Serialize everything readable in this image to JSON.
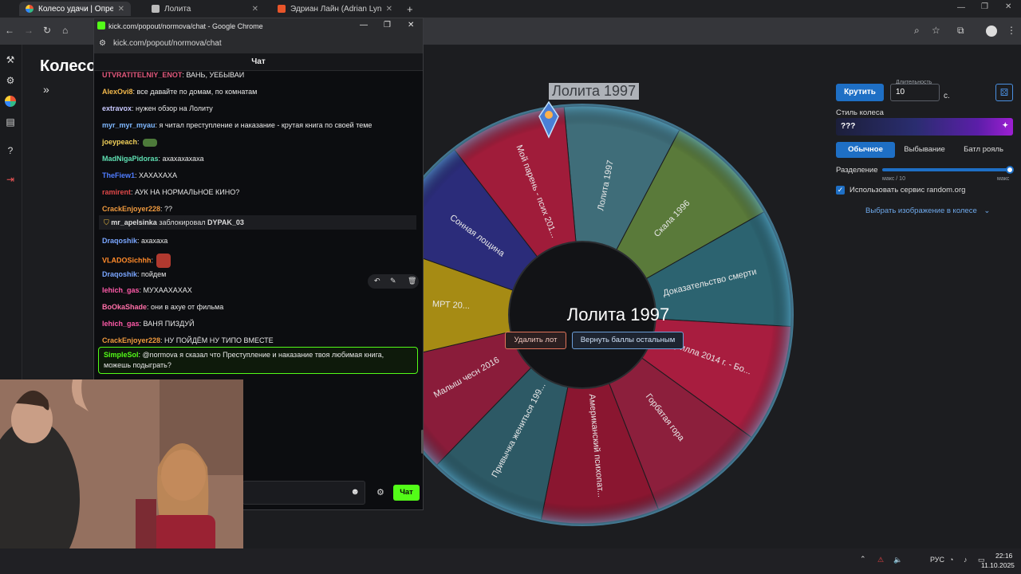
{
  "browser": {
    "tabs": [
      {
        "title": "Колесо удачи | Определите п",
        "active": true
      },
      {
        "title": "Лолита",
        "active": false
      },
      {
        "title": "Эдриан Лайн (Adrian Lyne): ф",
        "active": false
      }
    ],
    "new_tab": "+"
  },
  "app": {
    "heading": "Колесо",
    "collapse_icon": "»"
  },
  "wheel": {
    "top_label": "Лолита 1997",
    "center_title": "Лолита 1997",
    "delete_btn": "Удалить лот",
    "return_btn": "Вернуть баллы остальным",
    "segments": [
      {
        "label": "Лолита 1997",
        "color": "#3f6d79"
      },
      {
        "label": "Скала 1996",
        "color": "#5a7a3a"
      },
      {
        "label": "Доказательство смерти",
        "color": "#2c6370"
      },
      {
        "label": "Годзилла 2014 г. - Бо...",
        "color": "#a81d3f"
      },
      {
        "label": "Горбатая гора",
        "color": "#8c1f3c"
      },
      {
        "label": "Американский психопат...",
        "color": "#8a1630"
      },
      {
        "label": "Привычка жениться 199...",
        "color": "#2d5965"
      },
      {
        "label": "Малыш чесн 2016",
        "color": "#8a1c3a"
      },
      {
        "label": "МРТ 20...",
        "color": "#a68b14"
      },
      {
        "label": "Сонная лощина",
        "color": "#2b2c7a"
      },
      {
        "label": "Мой парень - псих 201...",
        "color": "#a01c3a"
      }
    ]
  },
  "controls": {
    "spin": "Крутить",
    "duration_label": "Длительность",
    "duration_value": "10",
    "duration_unit": "с.",
    "style_label": "Стиль колеса",
    "style_value": "???",
    "style_tabs": [
      "Обычное",
      "Выбывание",
      "Батл рояль"
    ],
    "split_label": "Разделение",
    "split_min": "макс / 10",
    "split_max": "макс",
    "split_fraction": 1.0,
    "randomorg_label": "Использовать сервис random.org",
    "choose_image": "Выбрать изображение в колесе"
  },
  "chat": {
    "window_title": "kick.com/popout/normova/chat - Google Chrome",
    "url": "kick.com/popout/normova/chat",
    "header": "Чат",
    "messages": [
      {
        "user": "UTVRATITELNIY_ENOT",
        "text": ": ВАНЬ, УЕБЫВАИ",
        "color": "#e0577a"
      },
      {
        "user": "AlexOvi8",
        "text": ": все давайте по домам, по комнатам",
        "color": "#f2b84b"
      },
      {
        "user": "extravox",
        "text": ": нужен обзор на Лолиту",
        "color": "#c9c9ff"
      },
      {
        "user": "myr_myr_myau",
        "text": ": я читал преступление и наказание - крутая книга по своей теме",
        "color": "#7fb8ff"
      },
      {
        "user": "joeypeach",
        "text": ":",
        "color": "#f2d15a"
      },
      {
        "user": "MadNigaPidoras",
        "text": ": ахахахахаха",
        "color": "#5fe0b3"
      },
      {
        "user": "TheFiew1",
        "text": ": ХАХАХАХА",
        "color": "#4f7cff"
      },
      {
        "user": "ramirent",
        "text": ": АУК НА НОРМАЛЬНОЕ КИНО?",
        "color": "#e04848"
      },
      {
        "user": "CrackEnjoyer228",
        "text": ": ??",
        "color": "#f09a3e"
      },
      {
        "user": "Draqoshik",
        "text": ": ахахаха",
        "color": "#7aa6ff"
      },
      {
        "user": "VLADOSichhh",
        "text": ":",
        "color": "#ff8a2a"
      },
      {
        "user": "Draqoshik",
        "text": ": пойдем",
        "color": "#7aa6ff"
      },
      {
        "user": "lehich_gas",
        "text": ": МУХААХАХАХ",
        "color": "#ff5aa8"
      },
      {
        "user": "BoOkaShade",
        "text": ": они в ахуе от фильма",
        "color": "#ff6fa8"
      },
      {
        "user": "lehich_gas",
        "text": ": ВАНЯ ПИЗДУЙ",
        "color": "#ff5aa8"
      },
      {
        "user": "CrackEnjoyer228",
        "text": ": НУ ПОЙДЁМ НУ ТИПО ВМЕСТЕ",
        "color": "#f09a3e"
      }
    ],
    "system": {
      "moderator": "mr_apelsinka",
      "action": "заблокировал",
      "target": "DYPAK_03"
    },
    "highlight": {
      "user": "SimpleSol",
      "line1": ": @normova я сказал что Преступление и наказание твоя любимая книга,",
      "line2": "можешь подыграть?"
    },
    "send": "Чат"
  },
  "taskbar": {
    "lang": "РУС",
    "time": "22:16",
    "date": "11.10.2025"
  }
}
